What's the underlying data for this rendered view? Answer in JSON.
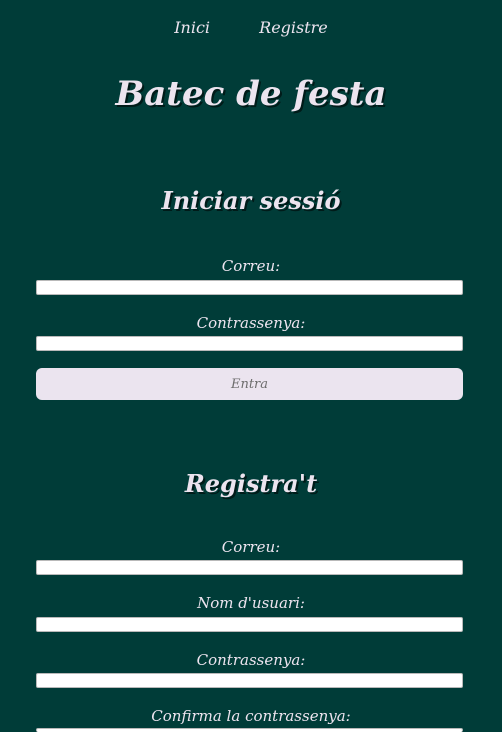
{
  "nav": {
    "home_label": "Inici",
    "register_label": "Registre"
  },
  "site_title": "Batec de festa",
  "login": {
    "heading": "Iniciar sessió",
    "email_label": "Correu:",
    "email_value": "",
    "password_label": "Contrassenya:",
    "password_value": "",
    "submit_label": "Entra"
  },
  "register": {
    "heading": "Registra't",
    "email_label": "Correu:",
    "email_value": "",
    "username_label": "Nom d'usuari:",
    "username_value": "",
    "password_label": "Contrassenya:",
    "password_value": "",
    "confirm_label": "Confirma la contrassenya:",
    "confirm_value": ""
  },
  "colors": {
    "background": "#003c38",
    "text": "#ece4ef",
    "button_bg": "#ebe4ef"
  }
}
